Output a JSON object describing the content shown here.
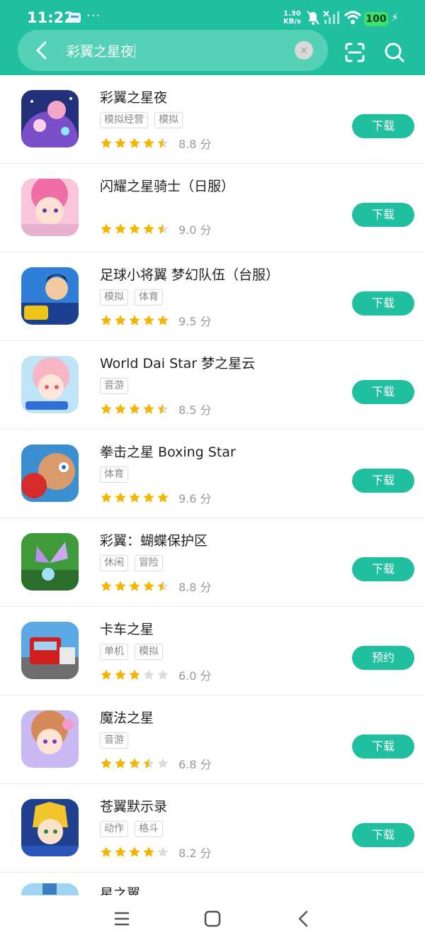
{
  "status_bar": {
    "time": "11:22",
    "dots": "···",
    "speed_value": "1.30",
    "speed_unit": "KB/s",
    "battery": "100",
    "icons": [
      "message-icon",
      "mute-icon",
      "signal-icon",
      "wifi-icon",
      "battery-icon",
      "charging-icon"
    ]
  },
  "search": {
    "query": "彩翼之星夜",
    "clear_symbol": "×"
  },
  "colors": {
    "accent": "#1fbf9f",
    "star_filled": "#f5b400",
    "star_empty": "#dddddd"
  },
  "apps": [
    {
      "name": "彩翼之星夜",
      "tags": [
        "模拟经营",
        "模拟"
      ],
      "stars": 4.5,
      "score": "8.8 分",
      "button": "下载"
    },
    {
      "name": "闪耀之星骑士（日服）",
      "tags": [],
      "stars": 4.5,
      "score": "9.0 分",
      "button": "下载"
    },
    {
      "name": "足球小将翼 梦幻队伍（台服）",
      "tags": [
        "模拟",
        "体育"
      ],
      "stars": 5,
      "score": "9.5 分",
      "button": "下载"
    },
    {
      "name": "World Dai Star  梦之星云",
      "tags": [
        "音游"
      ],
      "stars": 4.5,
      "score": "8.5 分",
      "button": "下载"
    },
    {
      "name": "拳击之星 Boxing Star",
      "tags": [
        "体育"
      ],
      "stars": 5,
      "score": "9.6 分",
      "button": "下载"
    },
    {
      "name": "彩翼：蝴蝶保护区",
      "tags": [
        "休闲",
        "冒险"
      ],
      "stars": 4.5,
      "score": "8.8 分",
      "button": "下载"
    },
    {
      "name": "卡车之星",
      "tags": [
        "单机",
        "模拟"
      ],
      "stars": 3,
      "score": "6.0 分",
      "button": "预约"
    },
    {
      "name": "魔法之星",
      "tags": [
        "音游"
      ],
      "stars": 3.5,
      "score": "6.8 分",
      "button": "下载"
    },
    {
      "name": "苍翼默示录",
      "tags": [
        "动作",
        "格斗"
      ],
      "stars": 4,
      "score": "8.2 分",
      "button": "下载"
    }
  ],
  "partial_app": {
    "name": "星之翼"
  },
  "nav": {
    "icons": [
      "menu-icon",
      "home-icon",
      "back-icon"
    ]
  }
}
